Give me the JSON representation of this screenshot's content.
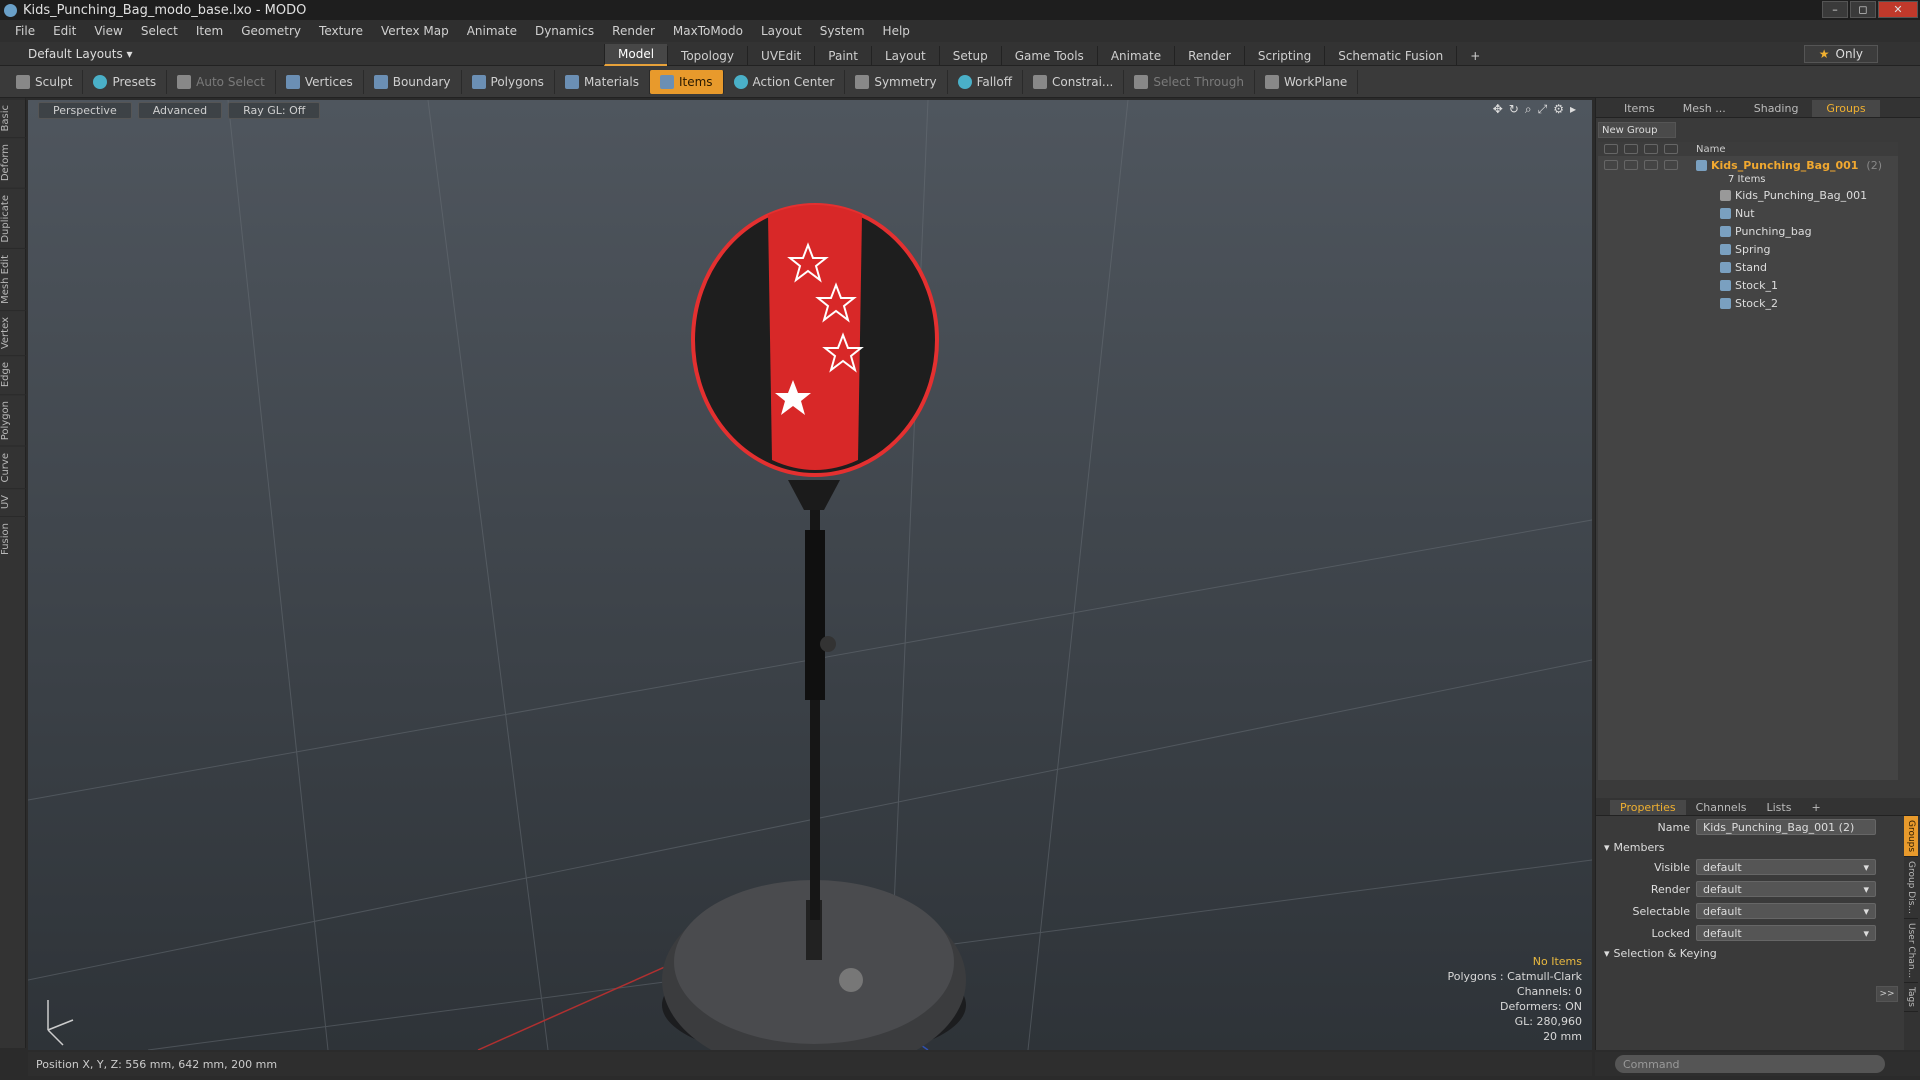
{
  "window": {
    "title": "Kids_Punching_Bag_modo_base.lxo - MODO",
    "controls": [
      "–",
      "◻",
      "✕"
    ]
  },
  "menu": [
    "File",
    "Edit",
    "View",
    "Select",
    "Item",
    "Geometry",
    "Texture",
    "Vertex Map",
    "Animate",
    "Dynamics",
    "Render",
    "MaxToModo",
    "Layout",
    "System",
    "Help"
  ],
  "layout": {
    "default_layouts": "Default Layouts ▾",
    "tabs": [
      "Model",
      "Topology",
      "UVEdit",
      "Paint",
      "Layout",
      "Setup",
      "Game Tools",
      "Animate",
      "Render",
      "Scripting",
      "Schematic Fusion"
    ],
    "active_tab": "Model",
    "plus": "+",
    "only": "Only"
  },
  "toolbar": {
    "sculpt": "Sculpt",
    "presets": "Presets",
    "auto_select": "Auto Select",
    "vertices": "Vertices",
    "boundary": "Boundary",
    "polygons": "Polygons",
    "materials": "Materials",
    "items": "Items",
    "action_center": "Action Center",
    "symmetry": "Symmetry",
    "falloff": "Falloff",
    "constraints": "Constrai...",
    "select_through": "Select Through",
    "workplane": "WorkPlane"
  },
  "left_tabs": [
    "Basic",
    "Deform",
    "Duplicate",
    "Mesh Edit",
    "Vertex",
    "Edge",
    "Polygon",
    "Curve",
    "UV",
    "Fusion"
  ],
  "viewport": {
    "perspective": "Perspective",
    "advanced": "Advanced",
    "raygl": "Ray GL: Off",
    "info": {
      "no_items": "No Items",
      "polygons": "Polygons : Catmull-Clark",
      "channels": "Channels: 0",
      "deformers": "Deformers: ON",
      "gl": "GL: 280,960",
      "scale": "20 mm"
    }
  },
  "status": {
    "position": "Position X, Y, Z:  556 mm, 642 mm, 200 mm"
  },
  "groups_panel": {
    "tabs": [
      "Items",
      "Mesh ...",
      "Shading",
      "Groups"
    ],
    "active_tab": "Groups",
    "new_group": "New Group",
    "name_header": "Name",
    "group_name": "Kids_Punching_Bag_001",
    "group_count": "(2)",
    "items_count": "7 Items",
    "items": [
      "Kids_Punching_Bag_001",
      "Nut",
      "Punching_bag",
      "Spring",
      "Stand",
      "Stock_1",
      "Stock_2"
    ]
  },
  "properties": {
    "tabs": [
      "Properties",
      "Channels",
      "Lists"
    ],
    "active_tab": "Properties",
    "plus": "+",
    "name_label": "Name",
    "name_value": "Kids_Punching_Bag_001 (2)",
    "members": "Members",
    "visible_label": "Visible",
    "visible_value": "default",
    "render_label": "Render",
    "render_value": "default",
    "selectable_label": "Selectable",
    "selectable_value": "default",
    "locked_label": "Locked",
    "locked_value": "default",
    "selection_keying": "Selection & Keying",
    "expand": ">>",
    "vtabs": [
      "Groups",
      "Group Dis...",
      "User Chan...",
      "Tags"
    ]
  },
  "command": {
    "placeholder": "Command"
  }
}
